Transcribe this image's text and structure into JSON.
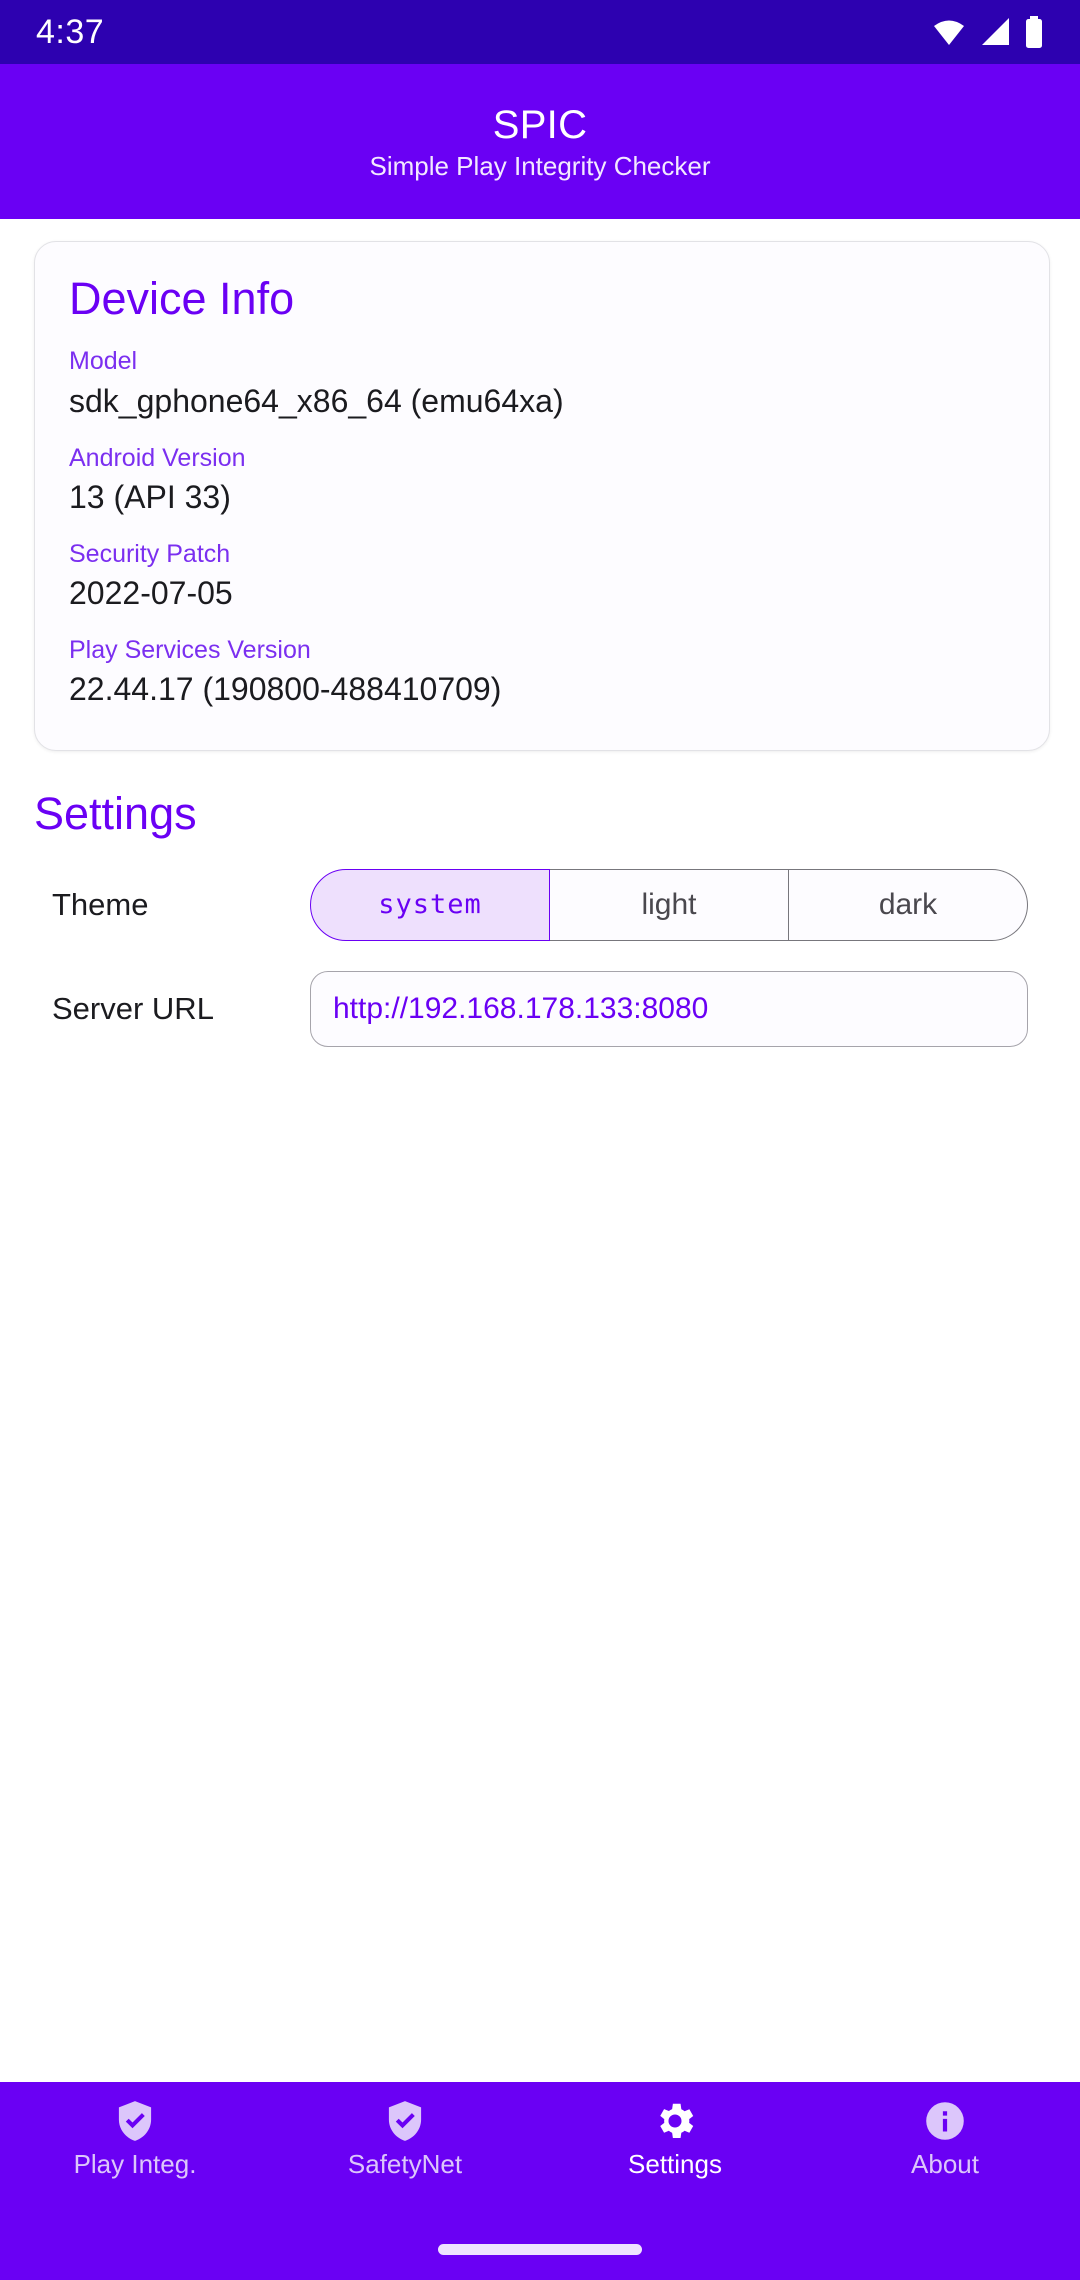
{
  "status_bar": {
    "clock": "4:37",
    "icons": [
      "wifi-icon",
      "cellular-signal-icon",
      "battery-icon"
    ]
  },
  "app_bar": {
    "title": "SPIC",
    "subtitle": "Simple Play Integrity Checker"
  },
  "device_info": {
    "card_title": "Device Info",
    "rows": [
      {
        "label": "Model",
        "value": "sdk_gphone64_x86_64 (emu64xa)"
      },
      {
        "label": "Android Version",
        "value": "13 (API 33)"
      },
      {
        "label": "Security Patch",
        "value": "2022-07-05"
      },
      {
        "label": "Play Services Version",
        "value": "22.44.17 (190800-488410709)"
      }
    ]
  },
  "settings": {
    "section_title": "Settings",
    "theme": {
      "label": "Theme",
      "options": [
        "system",
        "light",
        "dark"
      ],
      "selected": "system"
    },
    "server_url": {
      "label": "Server URL",
      "value": "http://192.168.178.133:8080",
      "placeholder": "http://192.168.178.133:8080"
    }
  },
  "bottom_nav": {
    "items": [
      {
        "label": "Play Integ.",
        "icon": "shield-check-icon",
        "active": false
      },
      {
        "label": "SafetyNet",
        "icon": "shield-check-icon",
        "active": false
      },
      {
        "label": "Settings",
        "icon": "gear-icon",
        "active": true
      },
      {
        "label": "About",
        "icon": "info-circle-icon",
        "active": false
      }
    ]
  },
  "colors": {
    "status_bar_bg": "#2d01b0",
    "brand_primary": "#6a00f4",
    "accent_label": "#7b2ff0",
    "selected_seg_bg": "#eee0fd",
    "nav_inactive": "#dcc6fb",
    "text_primary": "#1b1b1f"
  }
}
